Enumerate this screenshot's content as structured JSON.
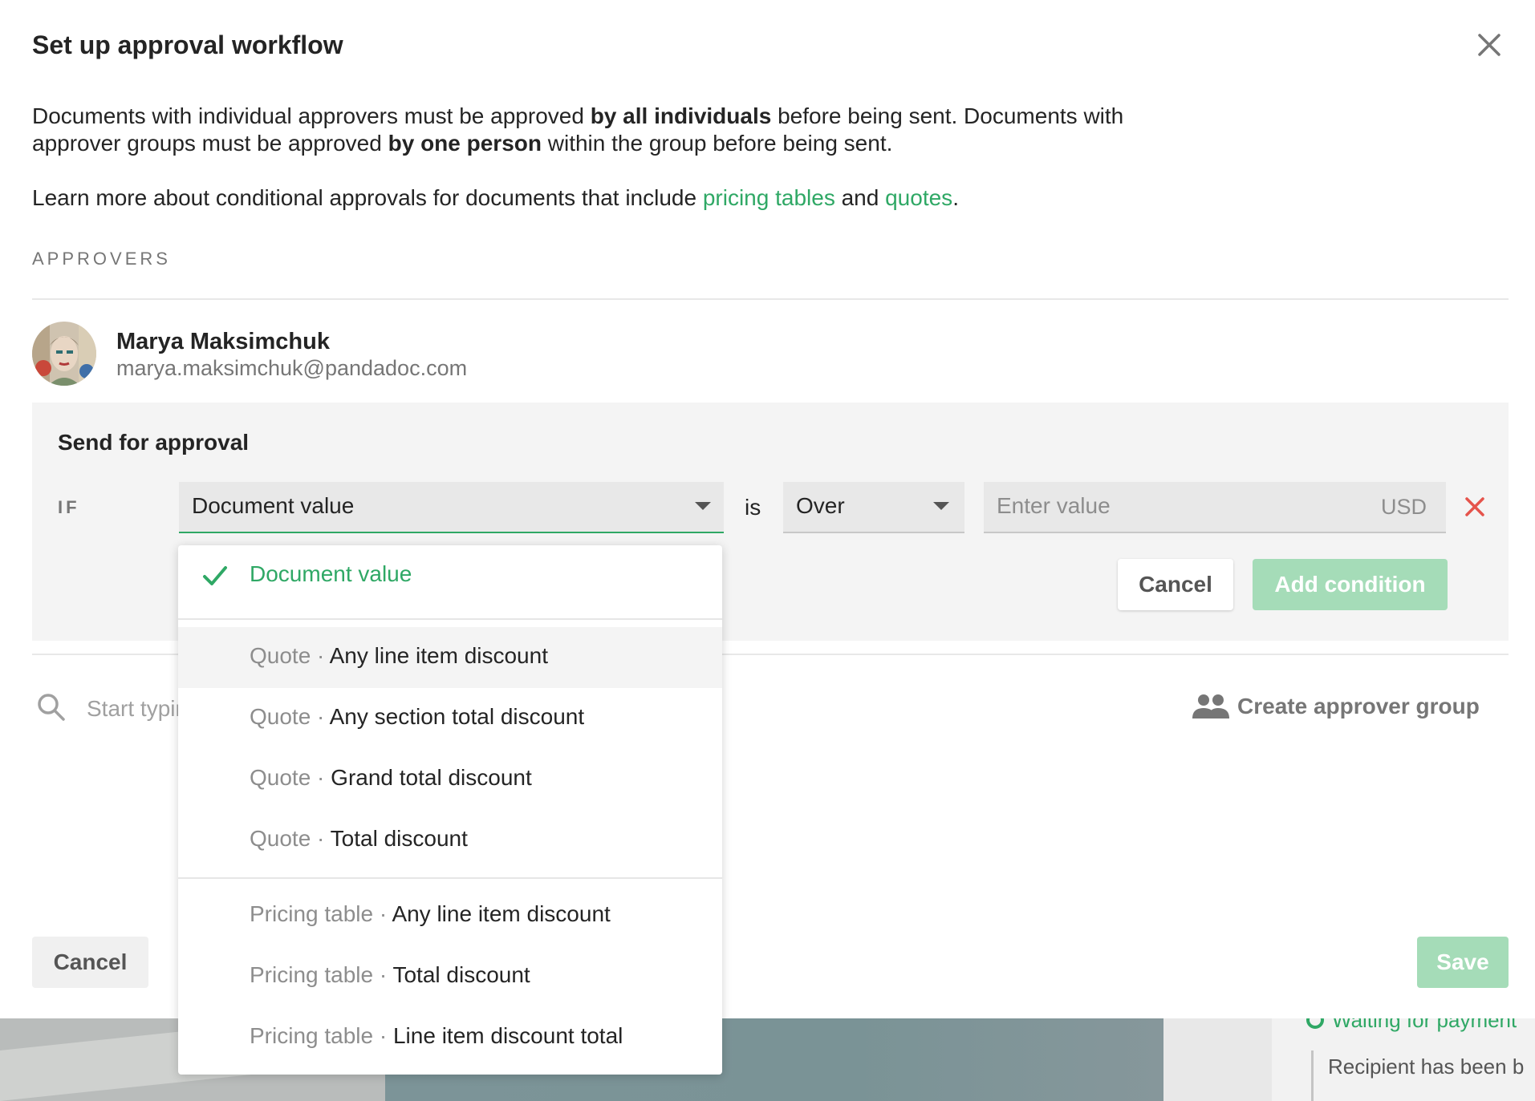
{
  "modal": {
    "title": "Set up approval workflow",
    "description": {
      "p1": "Documents with individual approvers must be approved ",
      "b1": "by all individuals",
      "p2": " before being sent. Documents with approver groups must be approved ",
      "b2": "by one person",
      "p3": " within the group before being sent."
    },
    "learn_more": {
      "prefix": "Learn more about conditional approvals for documents that include ",
      "link1": "pricing tables",
      "mid": " and ",
      "link2": "quotes",
      "suffix": "."
    },
    "section_label": "APPROVERS"
  },
  "approver": {
    "name": "Marya Maksimchuk",
    "email": "marya.maksimchuk@pandadoc.com"
  },
  "condition": {
    "title": "Send for approval",
    "if_label": "IF",
    "field_value": "Document value",
    "is_label": "is",
    "operator_value": "Over",
    "value_placeholder": "Enter value",
    "unit": "USD",
    "cancel_label": "Cancel",
    "add_label": "Add condition"
  },
  "search": {
    "placeholder": "Start typing"
  },
  "create_group_label": "Create approver group",
  "footer": {
    "cancel_label": "Cancel",
    "save_label": "Save"
  },
  "dropdown": {
    "selected": "Document value",
    "quote_group": "Quote",
    "pricing_group": "Pricing table",
    "dot": " · ",
    "quote_items": [
      "Any line item discount",
      "Any section total discount",
      "Grand total discount",
      "Total discount"
    ],
    "pricing_items": [
      "Any line item discount",
      "Total discount",
      "Line item discount total"
    ]
  },
  "background": {
    "waiting": "Waiting for payment",
    "recipient": "Recipient has been b"
  },
  "colors": {
    "accent": "#2fa865",
    "accent_disabled": "#a5dcb8",
    "danger": "#e5534b"
  }
}
